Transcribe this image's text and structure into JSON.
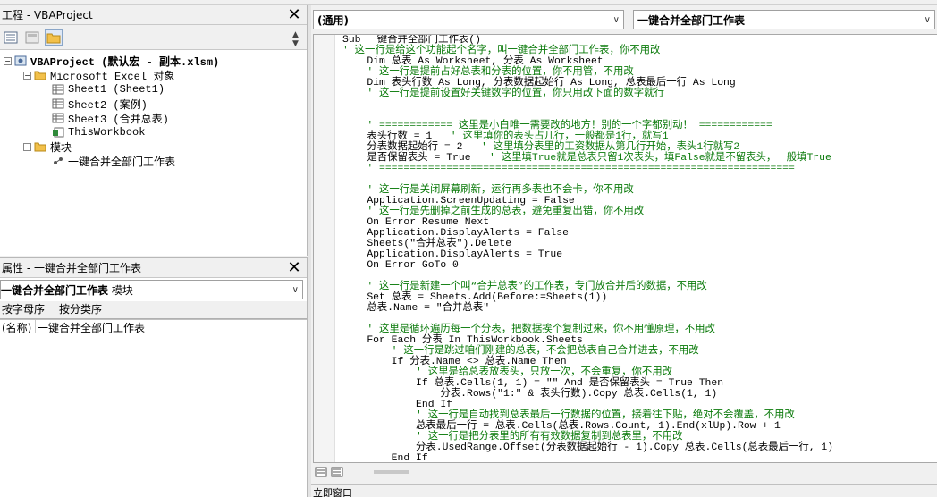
{
  "project_panel": {
    "title": "工程 - VBAProject",
    "tree": {
      "root": "VBAProject (默认宏 - 副本.xlsm)",
      "excel_objects": "Microsoft Excel 对象",
      "sheets": [
        "Sheet1 (Sheet1)",
        "Sheet2 (案例)",
        "Sheet3 (合并总表)",
        "ThisWorkbook"
      ],
      "modules": "模块",
      "module_item": "一键合并全部门工作表"
    }
  },
  "properties_panel": {
    "title": "属性 - 一键合并全部门工作表",
    "object_name": "一键合并全部门工作表",
    "object_type": "模块",
    "tabs": [
      "按字母序",
      "按分类序"
    ],
    "row_key": "(名称)",
    "row_value": "一键合并全部门工作表"
  },
  "code_window": {
    "object_combo": "(通用)",
    "proc_combo": "一键合并全部门工作表"
  },
  "immediate_title": "立即窗口",
  "code_lines": [
    {
      "t": "Sub 一键合并全部门工作表()",
      "c": 0
    },
    {
      "t": "' 这一行是给这个功能起个名字，叫一键合并全部门工作表，你不用改",
      "c": 1
    },
    {
      "t": "    Dim 总表 As Worksheet, 分表 As Worksheet",
      "c": 0
    },
    {
      "t": "    ' 这一行是提前占好总表和分表的位置，你不用管，不用改",
      "c": 1
    },
    {
      "t": "    Dim 表头行数 As Long, 分表数据起始行 As Long, 总表最后一行 As Long",
      "c": 0
    },
    {
      "t": "    ' 这一行是提前设置好关键数字的位置，你只用改下面的数字就行",
      "c": 1
    },
    {
      "t": "",
      "c": 0
    },
    {
      "t": "",
      "c": 0
    },
    {
      "t": "    ' ============ 这里是小白唯一需要改的地方！别的一个字都别动！ ============",
      "c": 1
    },
    {
      "t": "    表头行数 = 1   ' 这里填你的表头占几行，一般都是1行，就写1",
      "c": 2
    },
    {
      "t": "    分表数据起始行 = 2   ' 这里填分表里的工资数据从第几行开始，表头1行就写2",
      "c": 2
    },
    {
      "t": "    是否保留表头 = True   ' 这里填True就是总表只留1次表头，填False就是不留表头，一般填True",
      "c": 2
    },
    {
      "t": "    ' ====================================================================",
      "c": 1
    },
    {
      "t": "",
      "c": 0
    },
    {
      "t": "    ' 这一行是关闭屏幕刷新，运行再多表也不会卡，你不用改",
      "c": 1
    },
    {
      "t": "    Application.ScreenUpdating = False",
      "c": 0
    },
    {
      "t": "    ' 这一行是先删掉之前生成的总表，避免重复出错，你不用改",
      "c": 1
    },
    {
      "t": "    On Error Resume Next",
      "c": 0
    },
    {
      "t": "    Application.DisplayAlerts = False",
      "c": 0
    },
    {
      "t": "    Sheets(\"合并总表\").Delete",
      "c": 0
    },
    {
      "t": "    Application.DisplayAlerts = True",
      "c": 0
    },
    {
      "t": "    On Error GoTo 0",
      "c": 0
    },
    {
      "t": "",
      "c": 0
    },
    {
      "t": "    ' 这一行是新建一个叫“合并总表”的工作表，专门放合并后的数据，不用改",
      "c": 1
    },
    {
      "t": "    Set 总表 = Sheets.Add(Before:=Sheets(1))",
      "c": 0
    },
    {
      "t": "    总表.Name = \"合并总表\"",
      "c": 0
    },
    {
      "t": "",
      "c": 0
    },
    {
      "t": "    ' 这里是循环遍历每一个分表，把数据挨个复制过来，你不用懂原理，不用改",
      "c": 1
    },
    {
      "t": "    For Each 分表 In ThisWorkbook.Sheets",
      "c": 0
    },
    {
      "t": "        ' 这一行是跳过咱们刚建的总表，不会把总表自己合并进去，不用改",
      "c": 1
    },
    {
      "t": "        If 分表.Name <> 总表.Name Then",
      "c": 0
    },
    {
      "t": "            ' 这里是给总表放表头，只放一次，不会重复，你不用改",
      "c": 1
    },
    {
      "t": "            If 总表.Cells(1, 1) = \"\" And 是否保留表头 = True Then",
      "c": 0
    },
    {
      "t": "                分表.Rows(\"1:\" & 表头行数).Copy 总表.Cells(1, 1)",
      "c": 0
    },
    {
      "t": "            End If",
      "c": 0
    },
    {
      "t": "            ' 这一行是自动找到总表最后一行数据的位置，接着往下贴，绝对不会覆盖，不用改",
      "c": 1
    },
    {
      "t": "            总表最后一行 = 总表.Cells(总表.Rows.Count, 1).End(xlUp).Row + 1",
      "c": 0
    },
    {
      "t": "            ' 这一行是把分表里的所有有效数据复制到总表里，不用改",
      "c": 1
    },
    {
      "t": "            分表.UsedRange.Offset(分表数据起始行 - 1).Copy 总表.Cells(总表最后一行, 1)",
      "c": 0
    },
    {
      "t": "        End If",
      "c": 0
    }
  ]
}
